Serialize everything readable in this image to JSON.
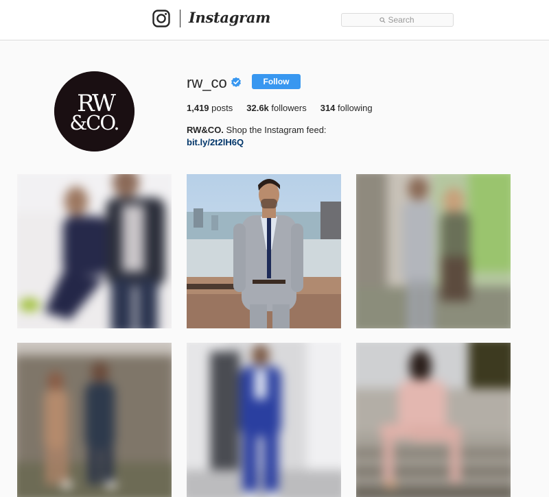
{
  "nav": {
    "wordmark": "Instagram",
    "search_placeholder": "Search"
  },
  "profile": {
    "username": "rw_co",
    "verified": true,
    "follow_label": "Follow",
    "avatar_text_top": "RW",
    "avatar_text_bottom": "&CO.",
    "stats": {
      "posts_count": "1,419",
      "posts_label": "posts",
      "followers_count": "32.6k",
      "followers_label": "followers",
      "following_count": "314",
      "following_label": "following"
    },
    "bio": {
      "name": "RW&CO.",
      "text": " Shop the Instagram feed:",
      "link": "bit.ly/2t2lH6Q"
    }
  },
  "colors": {
    "accent": "#3897f0",
    "link": "#003569",
    "background": "#fafafa"
  },
  "posts": [
    {
      "description": "couple posing, blurred"
    },
    {
      "description": "man in grey suit walking on rooftop"
    },
    {
      "description": "couple walking outdoors, blurred"
    },
    {
      "description": "couple standing by wall, blurred"
    },
    {
      "description": "man in blue suit, blurred"
    },
    {
      "description": "woman in pink suit seated on steps, blurred"
    }
  ]
}
